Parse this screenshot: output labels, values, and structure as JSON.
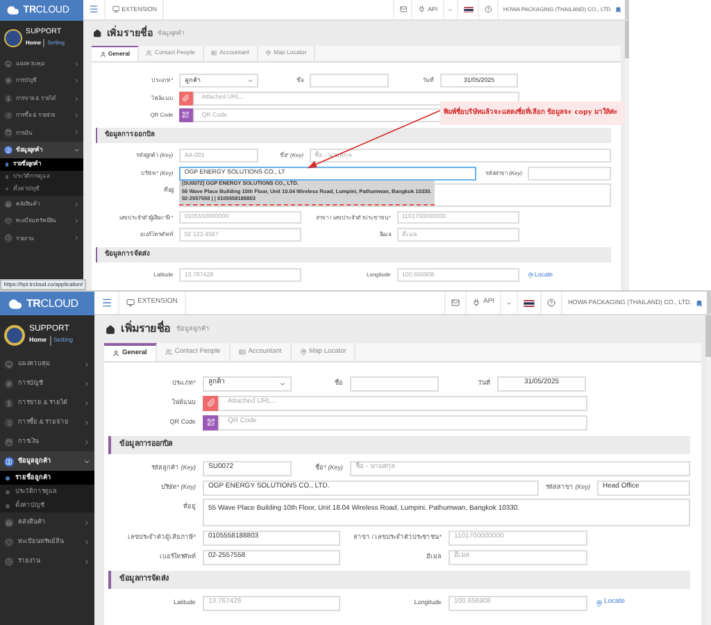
{
  "screens": [
    {
      "brand": "**TR**CLOUD",
      "user": "SUPPORT",
      "home": "Home",
      "setting": "Setting",
      "extension": "EXTENSION",
      "api": "API",
      "company_name": "HOWA PACKAGING (THAILAND) CO., LTD.",
      "sidebar": [
        {
          "label": "แผงควบคุม",
          "expanded": false
        },
        {
          "label": "การบัญชี",
          "expanded": false
        },
        {
          "label": "การขาย & รายได้",
          "expanded": false
        },
        {
          "label": "การซื้อ & รายจ่าย",
          "expanded": false
        },
        {
          "label": "การเงิน",
          "expanded": false
        },
        {
          "label": "ข้อมูลลูกค้า",
          "expanded": true,
          "children": [
            {
              "label": "รายชื่อลูกค้า",
              "selected": true
            },
            {
              "label": "ประวัติการดูแล",
              "selected": false
            },
            {
              "label": "ตั้งค่าบัญชี",
              "selected": false
            }
          ]
        },
        {
          "label": "คลังสินค้า",
          "expanded": false
        },
        {
          "label": "ทะเบียนทรัพย์สิน",
          "expanded": false
        },
        {
          "label": "รายงาน",
          "expanded": false
        }
      ],
      "title": "เพิ่มรายชื่อ",
      "subtitle": "ข้อมูลลูกค้า",
      "tabs": [
        {
          "label": "General",
          "selected": true
        },
        {
          "label": "Contact People",
          "selected": false
        },
        {
          "label": "Accountant",
          "selected": false
        },
        {
          "label": "Map Locator",
          "selected": false
        }
      ],
      "general": {
        "type": {
          "label": "ประเภท*",
          "value": "ลูกค้า"
        },
        "short_name": {
          "label": "ชื่อ"
        },
        "date": {
          "label": "วันที่",
          "value": "31/05/2025"
        },
        "attachment": {
          "label": "ไฟล์แนบ",
          "placeholder": "Attached URL..."
        },
        "qr": {
          "label": "QR Code",
          "placeholder": "QR Code"
        }
      },
      "billing": {
        "title": "ข้อมูลการออกบิล",
        "code": {
          "label": "รหัสลูกค้า *(Key)*",
          "placeholder": "AA-001"
        },
        "name": {
          "label": "ชื่อ* *(Key)*",
          "placeholder": "ชื่อ - นามสกุล"
        },
        "company": {
          "label": "บริษัท* *(Key)*",
          "value": "OGP ENERGY SOLUTIONS CO., LT",
          "focused": true
        },
        "branch": {
          "label": "รหัสสาขา *(Key)*"
        },
        "address": {
          "label": "ที่อยู่"
        },
        "tax_id": {
          "label": "เลขประจำตัวผู้เสียภาษี*",
          "placeholder": "0105550000000"
        },
        "branch_tax": {
          "label": "สาขา / เลขประจำตัวประชาชน*",
          "placeholder": "1101700000000"
        },
        "phone": {
          "label": "เบอร์โทรศัพท์",
          "placeholder": "02 123 4567"
        },
        "email": {
          "label": "อีเมล",
          "placeholder": "อีเมล"
        }
      },
      "suggestion": [
        "[SU0072] OGP ENERGY SOLUTIONS CO., LTD.",
        "55 Wave Place Building 10th Floor, Unit 10.04 Wireless Road, Lumpini, Pathumwan, Bangkok 10330.",
        "02-2557558 | | 0105558188803"
      ],
      "annotation": "พิมพ์ชื่อบริษัทแล้วจะแสดงชื่อที่เลือก ข้อมูลจะ copy มาให้ค่ะ",
      "shipping": {
        "title": "ข้อมูลการจัดส่ง",
        "latitude": {
          "label": "Latitude",
          "placeholder": "13.767428"
        },
        "longitude": {
          "label": "Longitude",
          "placeholder": "100.656908"
        },
        "locate": "Locate"
      },
      "status_url": "https://hpt.trcloud.co/application/"
    },
    {
      "brand": "**TR**CLOUD",
      "user": "SUPPORT",
      "home": "Home",
      "setting": "Setting",
      "extension": "EXTENSION",
      "api": "API",
      "company_name": "HOWA PACKAGING (THAILAND) CO., LTD.",
      "sidebar": [
        {
          "label": "แผงควบคุม",
          "expanded": false
        },
        {
          "label": "การบัญชี",
          "expanded": false
        },
        {
          "label": "การขาย & รายได้",
          "expanded": false
        },
        {
          "label": "การซื้อ & รายจ่าย",
          "expanded": false
        },
        {
          "label": "การเงิน",
          "expanded": false
        },
        {
          "label": "ข้อมูลลูกค้า",
          "expanded": true,
          "children": [
            {
              "label": "รายชื่อลูกค้า",
              "selected": true
            },
            {
              "label": "ประวัติการดูแล",
              "selected": false
            },
            {
              "label": "ตั้งค่าบัญชี",
              "selected": false
            }
          ]
        },
        {
          "label": "คลังสินค้า",
          "expanded": false
        },
        {
          "label": "ทะเบียนทรัพย์สิน",
          "expanded": false
        },
        {
          "label": "รายงาน",
          "expanded": false
        }
      ],
      "title": "เพิ่มรายชื่อ",
      "subtitle": "ข้อมูลลูกค้า",
      "tabs": [
        {
          "label": "General",
          "selected": true
        },
        {
          "label": "Contact People",
          "selected": false
        },
        {
          "label": "Accountant",
          "selected": false
        },
        {
          "label": "Map Locator",
          "selected": false
        }
      ],
      "general": {
        "type": {
          "label": "ประเภท*",
          "value": "ลูกค้า"
        },
        "short_name": {
          "label": "ชื่อ"
        },
        "date": {
          "label": "วันที่",
          "value": "31/05/2025"
        },
        "attachment": {
          "label": "ไฟล์แนบ",
          "placeholder": "Attached URL..."
        },
        "qr": {
          "label": "QR Code",
          "placeholder": "QR Code"
        }
      },
      "billing": {
        "title": "ข้อมูลการออกบิล",
        "code": {
          "label": "รหัสลูกค้า *(Key)*",
          "value": "SU0072"
        },
        "name": {
          "label": "ชื่อ* *(Key)*",
          "placeholder": "ชื่อ - นามสกุล"
        },
        "company": {
          "label": "บริษัท* *(Key)*",
          "value": "OGP ENERGY SOLUTIONS CO., LTD.",
          "focused": false
        },
        "branch": {
          "label": "รหัสสาขา *(Key)*",
          "value": "Head Office"
        },
        "address": {
          "label": "ที่อยู่",
          "value": "55 Wave Place Building 10th Floor, Unit 18.04 Wireless Road, Lumpini, Pathumwan, Bangkok 10330."
        },
        "tax_id": {
          "label": "เลขประจำตัวผู้เสียภาษี*",
          "value": "0105558188803"
        },
        "branch_tax": {
          "label": "สาขา / เลขประจำตัวประชาชน*",
          "placeholder": "1101700000000"
        },
        "phone": {
          "label": "เบอร์โทรศัพท์",
          "value": "02-2557558"
        },
        "email": {
          "label": "อีเมล",
          "placeholder": "อีเมล"
        }
      },
      "shipping": {
        "title": "ข้อมูลการจัดส่ง",
        "latitude": {
          "label": "Latitude",
          "placeholder": "13.767428"
        },
        "longitude": {
          "label": "Longitude",
          "placeholder": "100.656908"
        },
        "locate": "Locate"
      }
    }
  ]
}
